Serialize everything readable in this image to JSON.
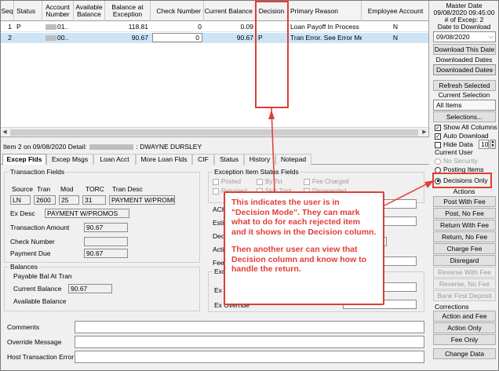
{
  "grid": {
    "columns": [
      "Seq",
      "Status",
      "Account Number",
      "Available Balance",
      "Balance at Exception",
      "Check Number",
      "Current Balance",
      "Decision",
      "Primary Reason",
      "Employee Account"
    ],
    "rows": [
      {
        "seq": "1",
        "status": "P",
        "account": "01..",
        "available": "",
        "balance_at_exception": "118.81",
        "check_number": "0",
        "current_balance": "0.09",
        "decision": "",
        "primary_reason": "Loan Payoff In Process",
        "employee_account": "N",
        "selected": false
      },
      {
        "seq": "2",
        "status": "",
        "account": "00..",
        "available": "",
        "balance_at_exception": "90.67",
        "check_number": "0",
        "current_balance": "90.67",
        "decision": "P",
        "primary_reason": "Tran Error. See Error Me...",
        "employee_account": "N",
        "selected": true
      }
    ]
  },
  "right_panel": {
    "master_date_label": "Master Date",
    "master_date_value": "09/08/2020  09:45:00",
    "excep_count": "# of Excep: 2",
    "date_to_download_label": "Date to Download",
    "date_to_download_value": "09/08/2020",
    "download_this_date": "Download This Date",
    "downloaded_dates_label": "Downloaded Dates",
    "downloaded_dates_value": "Downloaded Dates",
    "refresh_selected": "Refresh Selected",
    "current_selection_label": "Current Selection",
    "current_selection_value": "All Items",
    "selections_button": "Selections...",
    "show_all_columns": "Show All Columns",
    "auto_download": "Auto Download",
    "hide_data": "Hide Data",
    "hide_data_value": "10",
    "current_user_label": "Current User",
    "no_security": "No Security",
    "posting_items": "Posting Items",
    "decisions_only": "Decisions Only",
    "actions_label": "Actions",
    "actions": [
      "Post With Fee",
      "Post, No Fee",
      "Return With Fee",
      "Return, No Fee",
      "Charge Fee",
      "Disregard"
    ],
    "disabled_actions": [
      "Reverse With Fee",
      "Reverse, No Fee",
      "Bank First Deposit"
    ],
    "corrections_label": "Corrections",
    "corrections": [
      "Action and Fee",
      "Action Only",
      "Fee Only"
    ],
    "change_data": "Change Data"
  },
  "detail": {
    "prefix": "Item 2 on 09/08/2020 Detail:",
    "name": ": DWAYNE DURSLEY"
  },
  "tabs": [
    "Excep Flds",
    "Excep Msgs",
    "Loan Acct",
    "More Loan Flds",
    "CIF",
    "Status",
    "History",
    "Notepad"
  ],
  "transaction_fields": {
    "title": "Transaction Fields",
    "headers": [
      "Source",
      "Tran",
      "Mod",
      "TORC",
      "Tran Desc"
    ],
    "values": [
      "LN",
      "2600",
      "25",
      "31",
      "PAYMENT W/PROMOS"
    ],
    "ex_desc_label": "Ex Desc",
    "ex_desc_value": "PAYMENT W/PROMOS",
    "transaction_amount_label": "Transaction Amount",
    "transaction_amount_value": "90.67",
    "check_number_label": "Check Number",
    "check_number_value": "",
    "payment_due_label": "Payment Due",
    "payment_due_value": "90.67"
  },
  "balances": {
    "title": "Balances",
    "payable_label": "Payable Bal At Tran",
    "current_label": "Current Balance",
    "current_value": "90.67",
    "available_label": "Available Balance"
  },
  "exception_status": {
    "title": "Exception Item Status Fields",
    "checks": [
      "Posted",
      "By Tst",
      "Fee Charged",
      "Returned",
      "Skip Tpnt",
      "Disregarded"
    ],
    "labels": [
      "ACH F",
      "Estima",
      "Decisi",
      "Action",
      "Fee De",
      "Excep",
      "Ex Re",
      "Ex Override"
    ]
  },
  "bottom": {
    "comments_label": "Comments",
    "override_label": "Override Message",
    "host_error_label": "Host Transaction Error"
  },
  "callout": {
    "para1": "This indicates the user is in \"Decision Mode\". They can mark what to do for each rejected item and it shows in the Decision column.",
    "para2": "Then another user can view that Decision column and know how to handle the return."
  },
  "accent_color": "#e03d36",
  "selection_color": "#cce4f7"
}
